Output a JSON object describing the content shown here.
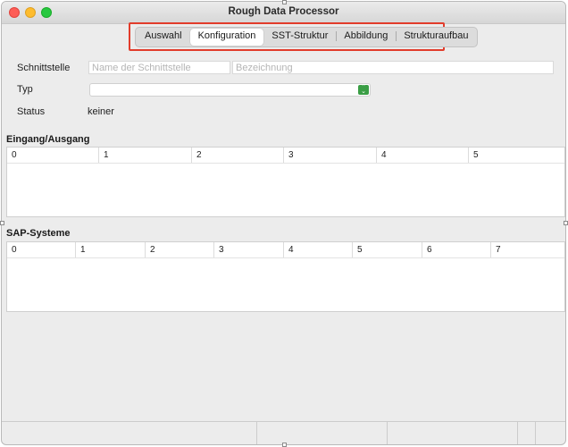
{
  "window": {
    "title": "Rough Data Processor"
  },
  "tabs": [
    {
      "label": "Auswahl"
    },
    {
      "label": "Konfiguration"
    },
    {
      "label": "SST-Struktur"
    },
    {
      "label": "Abbildung"
    },
    {
      "label": "Strukturaufbau"
    }
  ],
  "selected_tab": "Konfiguration",
  "highlight_color": "#e23c2b",
  "form": {
    "schnittstelle_label": "Schnittstelle",
    "name_placeholder": "Name der Schnittstelle",
    "bezeichnung_placeholder": "Bezeichnung",
    "typ_label": "Typ",
    "typ_value": "",
    "status_label": "Status",
    "status_value": "keiner"
  },
  "io_table": {
    "title": "Eingang/Ausgang",
    "columns": [
      "0",
      "1",
      "2",
      "3",
      "4",
      "5"
    ],
    "rows": []
  },
  "sap_table": {
    "title": "SAP-Systeme",
    "columns": [
      "0",
      "1",
      "2",
      "3",
      "4",
      "5",
      "6",
      "7"
    ],
    "rows": []
  }
}
